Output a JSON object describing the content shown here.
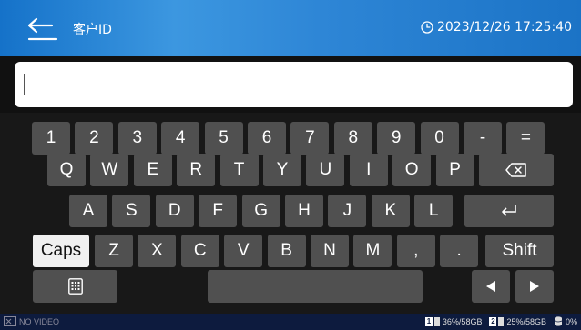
{
  "header": {
    "title": "客户ID",
    "datetime": "2023/12/26 17:25:40"
  },
  "input": {
    "value": "",
    "placeholder": ""
  },
  "keyboard": {
    "row1": [
      "1",
      "2",
      "3",
      "4",
      "5",
      "6",
      "7",
      "8",
      "9",
      "0",
      "-",
      "="
    ],
    "row2": [
      "Q",
      "W",
      "E",
      "R",
      "T",
      "Y",
      "U",
      "I",
      "O",
      "P"
    ],
    "row3": [
      "A",
      "S",
      "D",
      "F",
      "G",
      "H",
      "J",
      "K",
      "L"
    ],
    "row4": [
      "Z",
      "X",
      "C",
      "V",
      "B",
      "N",
      "M",
      ",",
      "."
    ],
    "caps_label": "Caps",
    "shift_label": "Shift",
    "backspace_icon": "backspace-icon",
    "enter_icon": "enter-icon",
    "layout_icon": "keyboard-grid-icon",
    "left_icon": "arrow-left-icon",
    "right_icon": "arrow-right-icon"
  },
  "status": {
    "video": "NO VIDEO",
    "disk1_id": "1",
    "disk1": "36%/58GB",
    "disk2_id": "2",
    "disk2": "25%/58GB",
    "storage": "0%"
  },
  "colors": {
    "header_accent": "#2e86d6",
    "key_bg": "#505050",
    "key_active_bg": "#f0f0f0",
    "statusbar_bg": "#0d1b3e"
  }
}
